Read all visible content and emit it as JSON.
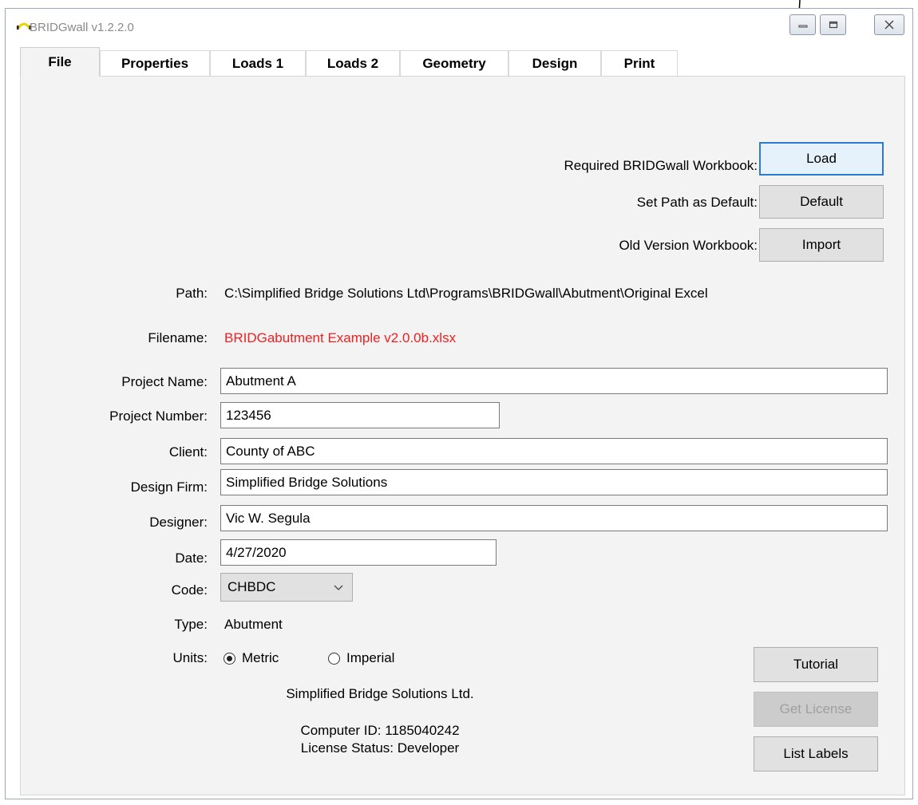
{
  "window": {
    "title": "BRIDGwall v1.2.2.0",
    "controls": {
      "minimize": "minimize",
      "maximize": "maximize",
      "close": "close"
    }
  },
  "tabs": [
    "File",
    "Properties",
    "Loads 1",
    "Loads 2",
    "Geometry",
    "Design",
    "Print"
  ],
  "active_tab": "File",
  "workbook": {
    "required_label": "Required BRIDGwall Workbook:",
    "load_button": "Load",
    "default_label": "Set Path as Default:",
    "default_button": "Default",
    "old_label": "Old Version Workbook:",
    "import_button": "Import"
  },
  "file_info": {
    "path_label": "Path:",
    "path_value": "C:\\Simplified Bridge Solutions Ltd\\Programs\\BRIDGwall\\Abutment\\Original Excel",
    "filename_label": "Filename:",
    "filename_value": "BRIDGabutment Example v2.0.0b.xlsx",
    "filename_color": "#f02020"
  },
  "form": {
    "project_name_label": "Project Name:",
    "project_name": "Abutment A",
    "project_number_label": "Project Number:",
    "project_number": "123456",
    "client_label": "Client:",
    "client": "County of ABC",
    "design_firm_label": "Design Firm:",
    "design_firm": "Simplified Bridge Solutions",
    "designer_label": "Designer:",
    "designer": "Vic W. Segula",
    "date_label": "Date:",
    "date": "4/27/2020",
    "code_label": "Code:",
    "code": "CHBDC",
    "type_label": "Type:",
    "type": "Abutment",
    "units_label": "Units:",
    "units_options": [
      "Metric",
      "Imperial"
    ],
    "units_selected": "Metric"
  },
  "footer": {
    "company": "Simplified Bridge Solutions Ltd.",
    "computer_id": "Computer ID: 1185040242",
    "license_status": "License Status: Developer",
    "tutorial_button": "Tutorial",
    "get_license_button": "Get License",
    "list_labels_button": "List Labels"
  },
  "colors": {
    "focus_border": "#2b7bd2",
    "panel_bg": "#f3f3f3",
    "button_bg": "#e1e1e1"
  }
}
